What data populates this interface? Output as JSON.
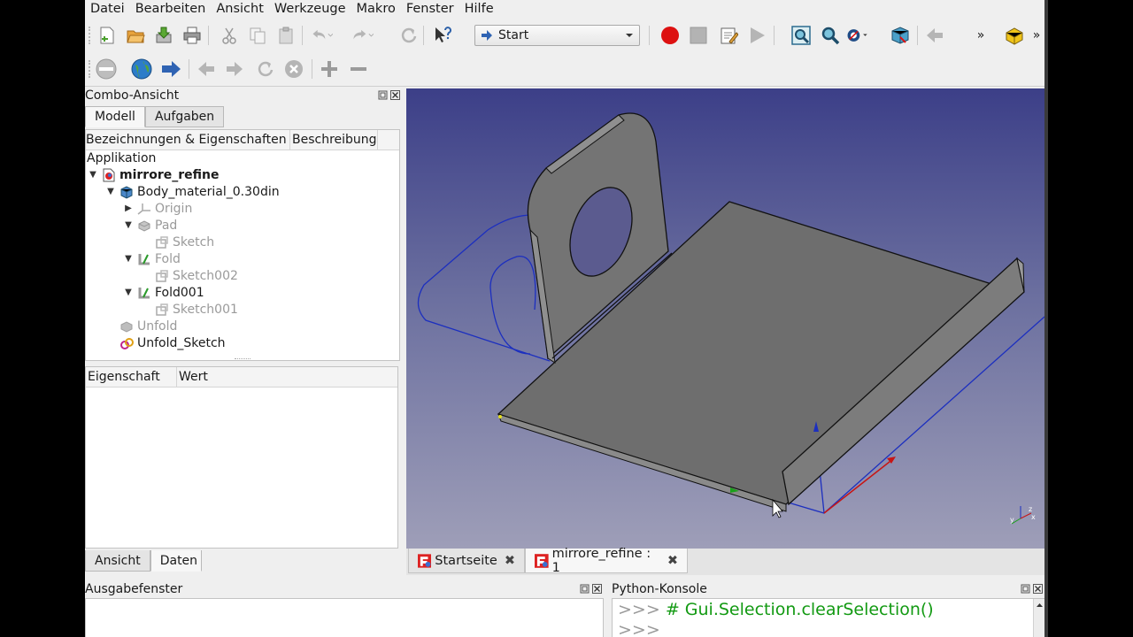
{
  "menubar": {
    "items": [
      "Datei",
      "Bearbeiten",
      "Ansicht",
      "Werkzeuge",
      "Makro",
      "Fenster",
      "Hilfe"
    ]
  },
  "toolbar": {
    "workbench": "Start",
    "overflow": "»"
  },
  "combo": {
    "title": "Combo-Ansicht",
    "tabs": [
      "Modell",
      "Aufgaben"
    ],
    "tree_headers": [
      "Bezeichnungen & Eigenschaften",
      "Beschreibung"
    ],
    "tree": {
      "root": "Applikation",
      "items": [
        {
          "label": "mirrore_refine",
          "level": 0,
          "arrow": "down",
          "icon": "document-icon",
          "bold": true,
          "dim": false
        },
        {
          "label": "Body_material_0.30din",
          "level": 1,
          "arrow": "down",
          "icon": "body-icon",
          "bold": false,
          "dim": false
        },
        {
          "label": "Origin",
          "level": 2,
          "arrow": "right",
          "icon": "origin-icon",
          "bold": false,
          "dim": true
        },
        {
          "label": "Pad",
          "level": 2,
          "arrow": "down",
          "icon": "pad-icon",
          "bold": false,
          "dim": true
        },
        {
          "label": "Sketch",
          "level": 3,
          "arrow": "",
          "icon": "sketch-icon",
          "bold": false,
          "dim": true
        },
        {
          "label": "Fold",
          "level": 2,
          "arrow": "down",
          "icon": "fold-icon",
          "bold": false,
          "dim": true
        },
        {
          "label": "Sketch002",
          "level": 3,
          "arrow": "",
          "icon": "sketch-icon",
          "bold": false,
          "dim": true
        },
        {
          "label": "Fold001",
          "level": 2,
          "arrow": "down",
          "icon": "fold-icon",
          "bold": false,
          "dim": false
        },
        {
          "label": "Sketch001",
          "level": 3,
          "arrow": "",
          "icon": "sketch-icon",
          "bold": false,
          "dim": true
        },
        {
          "label": "Unfold",
          "level": 1,
          "arrow": "",
          "icon": "unfold-icon",
          "bold": false,
          "dim": true
        },
        {
          "label": "Unfold_Sketch",
          "level": 1,
          "arrow": "",
          "icon": "unfold-sketch-icon",
          "bold": false,
          "dim": false
        }
      ]
    },
    "prop_headers": [
      "Eigenschaft",
      "Wert"
    ],
    "bottom_tabs": [
      "Ansicht",
      "Daten"
    ]
  },
  "doc_tabs": [
    {
      "label": "Startseite",
      "active": false
    },
    {
      "label": "mirrore_refine : 1",
      "active": true
    }
  ],
  "output": {
    "title": "Ausgabefenster"
  },
  "python": {
    "title": "Python-Konsole",
    "prompt": ">>>",
    "line1": "# Gui.Selection.clearSelection()",
    "line2": ""
  },
  "colors": {
    "viewport_top": "#3c3f88",
    "viewport_bottom": "#9e9eb8",
    "python_code": "#139a13",
    "record": "#dd1111"
  }
}
